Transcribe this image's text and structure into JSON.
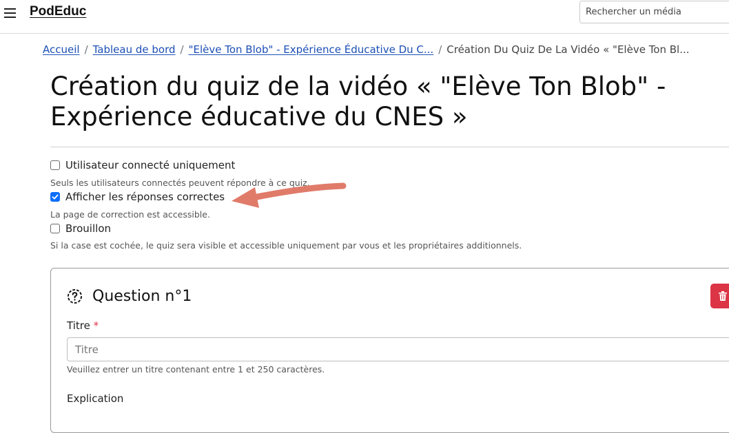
{
  "navbar": {
    "brand": "PodEduc",
    "search_placeholder": "Rechercher un média"
  },
  "breadcrumb": {
    "items": [
      "Accueil",
      "Tableau de bord",
      "\"Elève Ton Blob\" - Expérience Éducative Du C..."
    ],
    "current": "Création Du Quiz De La Vidéo « \"Elève Ton Bl..."
  },
  "page": {
    "title_line1": "Création du quiz de la vidéo « \"Elève Ton Blob\" -",
    "title_line2": "Expérience éducative du CNES »"
  },
  "options": [
    {
      "label": "Utilisateur connecté uniquement",
      "checked": false,
      "help": "Seuls les utilisateurs connectés peuvent répondre à ce quiz."
    },
    {
      "label": "Afficher les réponses correctes",
      "checked": true,
      "help": "La page de correction est accessible."
    },
    {
      "label": "Brouillon",
      "checked": false,
      "help": "Si la case est cochée, le quiz sera visible et accessible uniquement par vous et les propriétaires additionnels."
    }
  ],
  "question": {
    "title": "Question n°1",
    "title_label": "Titre",
    "required_mark": "*",
    "title_placeholder": "Titre",
    "title_help": "Veuillez entrer un titre contenant entre 1 et 250 caractères.",
    "explanation_label": "Explication"
  },
  "colors": {
    "link": "#1b4fb5",
    "checkbox_checked": "#0d6efd",
    "danger": "#dc3545",
    "annotation_arrow": "#e07b6a"
  }
}
